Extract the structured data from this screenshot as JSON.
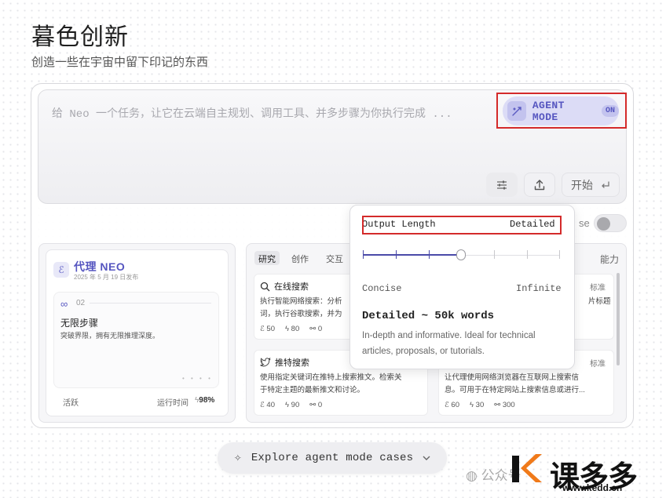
{
  "header": {
    "title": "暮色创新",
    "subtitle": "创造一些在宇宙中留下印记的东西"
  },
  "task": {
    "placeholder": "给 Neo 一个任务，让它在云端自主规划、调用工具、并多步骤为你执行完成 ...",
    "agent_mode_label": "AGENT MODE",
    "agent_mode_state": "ON",
    "start_label": "开始",
    "settings_icon": "sliders-icon",
    "upload_icon": "upload-icon",
    "enter_icon": "enter-icon"
  },
  "toggle": {
    "label_fragment": "se",
    "state": "off"
  },
  "agent_card": {
    "name": "代理 NEO",
    "date": "2025 年 5 月 19 日发布",
    "step_number": "02",
    "step_title": "无限步骤",
    "step_desc": "突破界限，拥有无限推理深度。",
    "status": "活跃",
    "runtime_label": "运行时间",
    "runtime_value": "98%"
  },
  "tabs": [
    {
      "label": "研究",
      "active": true
    },
    {
      "label": "创作",
      "active": false
    },
    {
      "label": "交互",
      "active": false
    }
  ],
  "tab_capability_fragment": "能力",
  "tools": [
    {
      "title": "在线搜索",
      "icon": "search-icon",
      "desc1": "执行智能网络搜索：分析",
      "desc2": "词，执行谷歌搜索，并为",
      "stats": [
        "50",
        "80",
        "0"
      ]
    },
    {
      "title": "推特搜索",
      "icon": "twitter-icon",
      "desc1": "使用指定关键词在推特上搜索推文。检索关",
      "desc2": "于特定主题的最新推文和讨论。",
      "stats": [
        "40",
        "90",
        "0"
      ]
    },
    {
      "tag": "标准",
      "desc_fragment": "片标题"
    },
    {
      "tag": "标准",
      "desc1": "让代理使用网络浏览器在互联网上搜索信",
      "desc2": "息。可用于在特定网站上搜索信息或进行...",
      "stats": [
        "60",
        "30",
        "300"
      ]
    }
  ],
  "popover": {
    "label": "Output Length",
    "value": "Detailed",
    "slider_level": 0.5,
    "min_label": "Concise",
    "max_label": "Infinite",
    "detail_title": "Detailed ~ 50k words",
    "detail_desc": "In-depth and informative. Ideal for technical articles, proposals, or tutorials."
  },
  "explore": {
    "label": "Explore agent mode cases"
  },
  "watermark": {
    "account": "公众号",
    "brand": "课多多",
    "url": "www.kedd.cn"
  },
  "colors": {
    "accent": "#5656c0",
    "highlight_box": "#d42a2a"
  }
}
